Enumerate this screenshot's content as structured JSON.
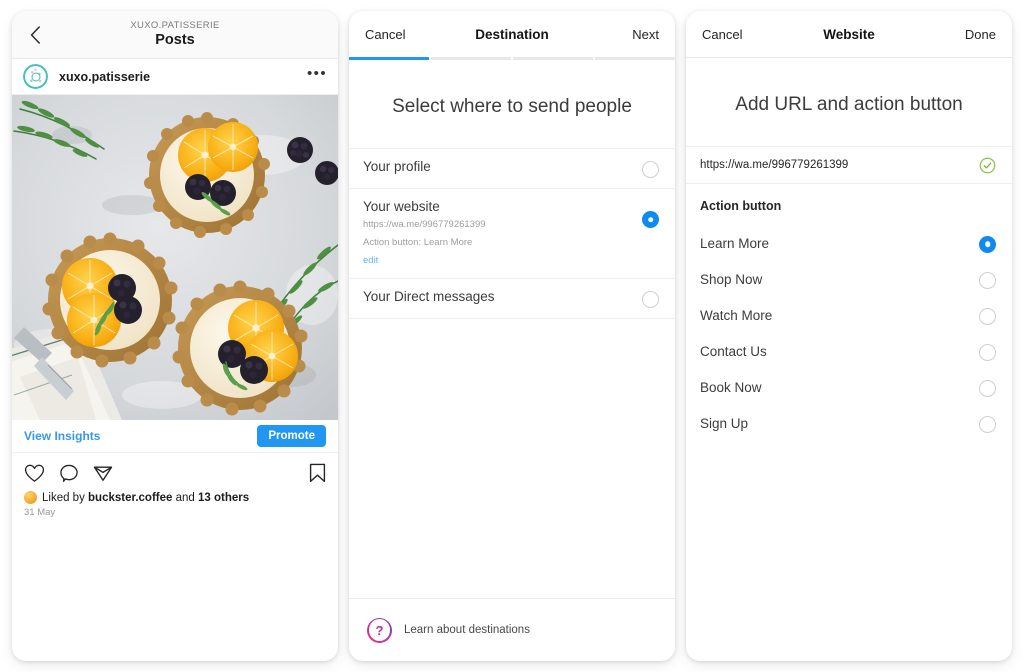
{
  "panel_post": {
    "nav": {
      "back_icon": "chevron-left-icon",
      "kicker": "XUXO.PATISSERIE",
      "title": "Posts"
    },
    "user": {
      "avatar_icon": "donut-avatar",
      "username": "xuxo.patisserie",
      "menu_icon": "more-options-icon"
    },
    "photo": {
      "alt": "Three orange and blackberry tartlets with rosemary on a marble surface"
    },
    "insights": {
      "view_insights_label": "View Insights",
      "promote_label": "Promote"
    },
    "actions": {
      "like_icon": "heart-icon",
      "comment_icon": "comment-icon",
      "share_icon": "share-icon",
      "save_icon": "bookmark-icon"
    },
    "likes": {
      "prefix": "Liked by ",
      "username": "buckster.coffee",
      "middle": " and ",
      "others": "13 others"
    },
    "date": "31 May"
  },
  "panel_destination": {
    "header": {
      "cancel_label": "Cancel",
      "title": "Destination",
      "next_label": "Next"
    },
    "progress": {
      "segments": 4,
      "active_index": 0
    },
    "heading": "Select where to send people",
    "options": [
      {
        "title": "Your profile",
        "selected": false
      },
      {
        "title": "Your website",
        "url": "https://wa.me/996779261399",
        "action_button_line": "Action button: Learn More",
        "edit_label": "edit",
        "selected": true
      },
      {
        "title": "Your Direct messages",
        "selected": false
      }
    ],
    "footer": {
      "help_icon": "question-mark-icon",
      "label": "Learn about destinations"
    }
  },
  "panel_website": {
    "header": {
      "cancel_label": "Cancel",
      "title": "Website",
      "done_label": "Done"
    },
    "heading": "Add URL and action button",
    "url_field": {
      "value": "https://wa.me/996779261399",
      "placeholder": "https://",
      "validation_icon": "check-circle-icon"
    },
    "section_label": "Action button",
    "action_buttons": [
      {
        "label": "Learn More",
        "selected": true
      },
      {
        "label": "Shop Now",
        "selected": false
      },
      {
        "label": "Watch More",
        "selected": false
      },
      {
        "label": "Contact Us",
        "selected": false
      },
      {
        "label": "Book Now",
        "selected": false
      },
      {
        "label": "Sign Up",
        "selected": false
      }
    ]
  },
  "colors": {
    "accent_blue": "#2196f3",
    "radio_blue": "#0d8bf2",
    "link_blue": "#3897f0",
    "valid_green": "#7dc242",
    "avatar_teal": "#3fc0bd"
  }
}
